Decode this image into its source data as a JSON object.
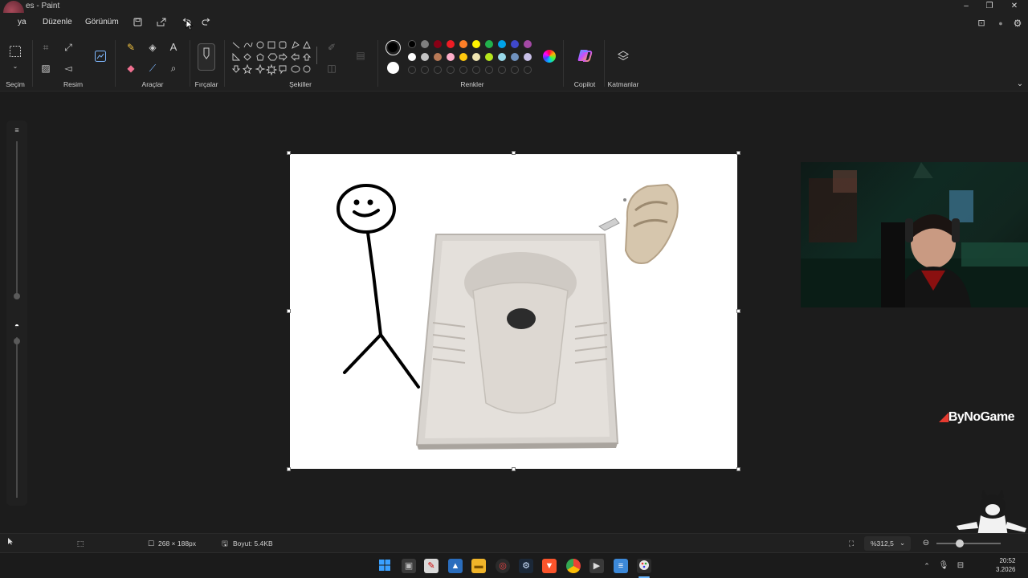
{
  "window": {
    "title": "es - Paint",
    "controls": {
      "minimize": "–",
      "maximize": "❐",
      "close": "✕"
    }
  },
  "menu": {
    "file": "ya",
    "edit": "Düzenle",
    "view": "Görünüm"
  },
  "ribbon": {
    "groups": {
      "selection": "Seçim",
      "image": "Resim",
      "tools": "Araçlar",
      "brushes": "Fırçalar",
      "shapes": "Şekiller",
      "colors": "Renkler",
      "copilot": "Copilot",
      "layers": "Katmanlar"
    },
    "palette_row1": [
      "#000000",
      "#7f7f7f",
      "#880015",
      "#ed1c24",
      "#ff7f27",
      "#fff200",
      "#22b14c",
      "#00a2e8",
      "#3f48cc",
      "#a349a4"
    ],
    "palette_row2": [
      "#ffffff",
      "#c3c3c3",
      "#b97a57",
      "#ffaec9",
      "#ffc90e",
      "#efe4b0",
      "#b5e61d",
      "#99d9ea",
      "#7092be",
      "#c8bfe7"
    ],
    "primary_color": "#000000",
    "secondary_color": "#ffffff"
  },
  "status": {
    "canvas_size": "268 × 188px",
    "file_size": "Boyut: 5.4KB",
    "zoom": "%312,5"
  },
  "overlay": {
    "brand": "ByNoGame"
  },
  "taskbar": {
    "clock_time": "20:52",
    "clock_date": "3.2026"
  }
}
